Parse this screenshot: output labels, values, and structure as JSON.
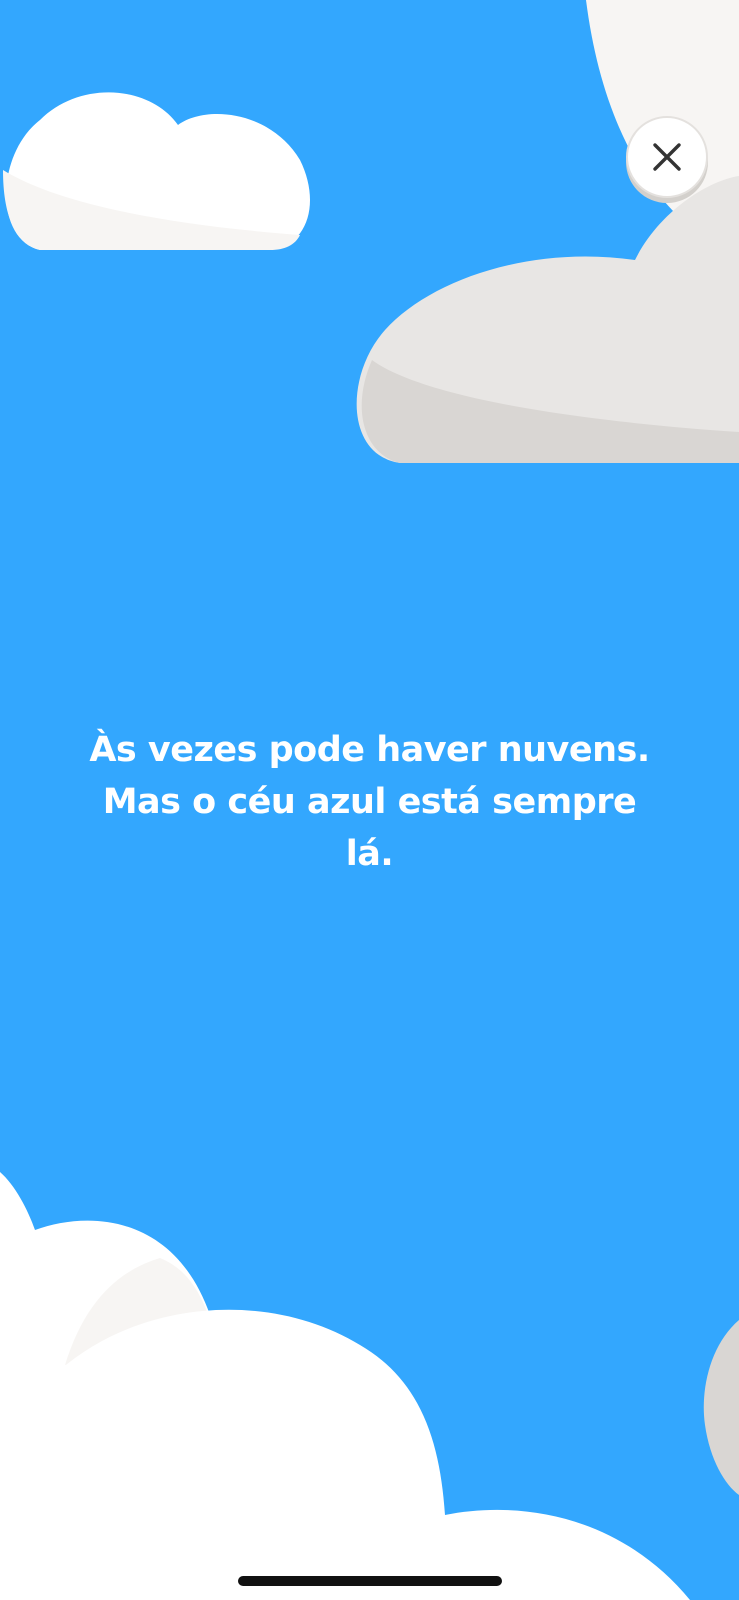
{
  "screen": {
    "background_color": "#33a7fe",
    "message": "Às vezes pode haver nuvens. Mas o céu azul está sempre lá."
  },
  "close_button": {
    "icon": "close-icon"
  },
  "colors": {
    "cloud_white": "#ffffff",
    "cloud_shade": "#f7f5f3",
    "cloud_grey": "#e8e6e4",
    "cloud_grey_shade": "#d9d6d3",
    "text": "#ffffff",
    "icon": "#333333"
  }
}
